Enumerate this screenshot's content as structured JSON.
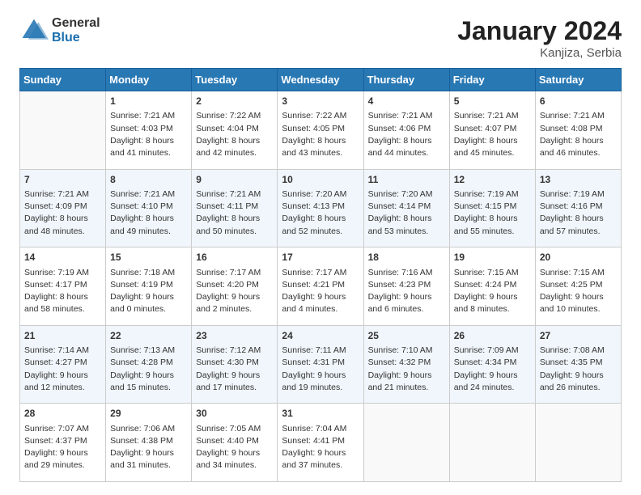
{
  "logo": {
    "general": "General",
    "blue": "Blue"
  },
  "title": "January 2024",
  "location": "Kanjiza, Serbia",
  "days_header": [
    "Sunday",
    "Monday",
    "Tuesday",
    "Wednesday",
    "Thursday",
    "Friday",
    "Saturday"
  ],
  "weeks": [
    [
      {
        "num": "",
        "lines": []
      },
      {
        "num": "1",
        "lines": [
          "Sunrise: 7:21 AM",
          "Sunset: 4:03 PM",
          "Daylight: 8 hours",
          "and 41 minutes."
        ]
      },
      {
        "num": "2",
        "lines": [
          "Sunrise: 7:22 AM",
          "Sunset: 4:04 PM",
          "Daylight: 8 hours",
          "and 42 minutes."
        ]
      },
      {
        "num": "3",
        "lines": [
          "Sunrise: 7:22 AM",
          "Sunset: 4:05 PM",
          "Daylight: 8 hours",
          "and 43 minutes."
        ]
      },
      {
        "num": "4",
        "lines": [
          "Sunrise: 7:21 AM",
          "Sunset: 4:06 PM",
          "Daylight: 8 hours",
          "and 44 minutes."
        ]
      },
      {
        "num": "5",
        "lines": [
          "Sunrise: 7:21 AM",
          "Sunset: 4:07 PM",
          "Daylight: 8 hours",
          "and 45 minutes."
        ]
      },
      {
        "num": "6",
        "lines": [
          "Sunrise: 7:21 AM",
          "Sunset: 4:08 PM",
          "Daylight: 8 hours",
          "and 46 minutes."
        ]
      }
    ],
    [
      {
        "num": "7",
        "lines": [
          "Sunrise: 7:21 AM",
          "Sunset: 4:09 PM",
          "Daylight: 8 hours",
          "and 48 minutes."
        ]
      },
      {
        "num": "8",
        "lines": [
          "Sunrise: 7:21 AM",
          "Sunset: 4:10 PM",
          "Daylight: 8 hours",
          "and 49 minutes."
        ]
      },
      {
        "num": "9",
        "lines": [
          "Sunrise: 7:21 AM",
          "Sunset: 4:11 PM",
          "Daylight: 8 hours",
          "and 50 minutes."
        ]
      },
      {
        "num": "10",
        "lines": [
          "Sunrise: 7:20 AM",
          "Sunset: 4:13 PM",
          "Daylight: 8 hours",
          "and 52 minutes."
        ]
      },
      {
        "num": "11",
        "lines": [
          "Sunrise: 7:20 AM",
          "Sunset: 4:14 PM",
          "Daylight: 8 hours",
          "and 53 minutes."
        ]
      },
      {
        "num": "12",
        "lines": [
          "Sunrise: 7:19 AM",
          "Sunset: 4:15 PM",
          "Daylight: 8 hours",
          "and 55 minutes."
        ]
      },
      {
        "num": "13",
        "lines": [
          "Sunrise: 7:19 AM",
          "Sunset: 4:16 PM",
          "Daylight: 8 hours",
          "and 57 minutes."
        ]
      }
    ],
    [
      {
        "num": "14",
        "lines": [
          "Sunrise: 7:19 AM",
          "Sunset: 4:17 PM",
          "Daylight: 8 hours",
          "and 58 minutes."
        ]
      },
      {
        "num": "15",
        "lines": [
          "Sunrise: 7:18 AM",
          "Sunset: 4:19 PM",
          "Daylight: 9 hours",
          "and 0 minutes."
        ]
      },
      {
        "num": "16",
        "lines": [
          "Sunrise: 7:17 AM",
          "Sunset: 4:20 PM",
          "Daylight: 9 hours",
          "and 2 minutes."
        ]
      },
      {
        "num": "17",
        "lines": [
          "Sunrise: 7:17 AM",
          "Sunset: 4:21 PM",
          "Daylight: 9 hours",
          "and 4 minutes."
        ]
      },
      {
        "num": "18",
        "lines": [
          "Sunrise: 7:16 AM",
          "Sunset: 4:23 PM",
          "Daylight: 9 hours",
          "and 6 minutes."
        ]
      },
      {
        "num": "19",
        "lines": [
          "Sunrise: 7:15 AM",
          "Sunset: 4:24 PM",
          "Daylight: 9 hours",
          "and 8 minutes."
        ]
      },
      {
        "num": "20",
        "lines": [
          "Sunrise: 7:15 AM",
          "Sunset: 4:25 PM",
          "Daylight: 9 hours",
          "and 10 minutes."
        ]
      }
    ],
    [
      {
        "num": "21",
        "lines": [
          "Sunrise: 7:14 AM",
          "Sunset: 4:27 PM",
          "Daylight: 9 hours",
          "and 12 minutes."
        ]
      },
      {
        "num": "22",
        "lines": [
          "Sunrise: 7:13 AM",
          "Sunset: 4:28 PM",
          "Daylight: 9 hours",
          "and 15 minutes."
        ]
      },
      {
        "num": "23",
        "lines": [
          "Sunrise: 7:12 AM",
          "Sunset: 4:30 PM",
          "Daylight: 9 hours",
          "and 17 minutes."
        ]
      },
      {
        "num": "24",
        "lines": [
          "Sunrise: 7:11 AM",
          "Sunset: 4:31 PM",
          "Daylight: 9 hours",
          "and 19 minutes."
        ]
      },
      {
        "num": "25",
        "lines": [
          "Sunrise: 7:10 AM",
          "Sunset: 4:32 PM",
          "Daylight: 9 hours",
          "and 21 minutes."
        ]
      },
      {
        "num": "26",
        "lines": [
          "Sunrise: 7:09 AM",
          "Sunset: 4:34 PM",
          "Daylight: 9 hours",
          "and 24 minutes."
        ]
      },
      {
        "num": "27",
        "lines": [
          "Sunrise: 7:08 AM",
          "Sunset: 4:35 PM",
          "Daylight: 9 hours",
          "and 26 minutes."
        ]
      }
    ],
    [
      {
        "num": "28",
        "lines": [
          "Sunrise: 7:07 AM",
          "Sunset: 4:37 PM",
          "Daylight: 9 hours",
          "and 29 minutes."
        ]
      },
      {
        "num": "29",
        "lines": [
          "Sunrise: 7:06 AM",
          "Sunset: 4:38 PM",
          "Daylight: 9 hours",
          "and 31 minutes."
        ]
      },
      {
        "num": "30",
        "lines": [
          "Sunrise: 7:05 AM",
          "Sunset: 4:40 PM",
          "Daylight: 9 hours",
          "and 34 minutes."
        ]
      },
      {
        "num": "31",
        "lines": [
          "Sunrise: 7:04 AM",
          "Sunset: 4:41 PM",
          "Daylight: 9 hours",
          "and 37 minutes."
        ]
      },
      {
        "num": "",
        "lines": []
      },
      {
        "num": "",
        "lines": []
      },
      {
        "num": "",
        "lines": []
      }
    ]
  ]
}
